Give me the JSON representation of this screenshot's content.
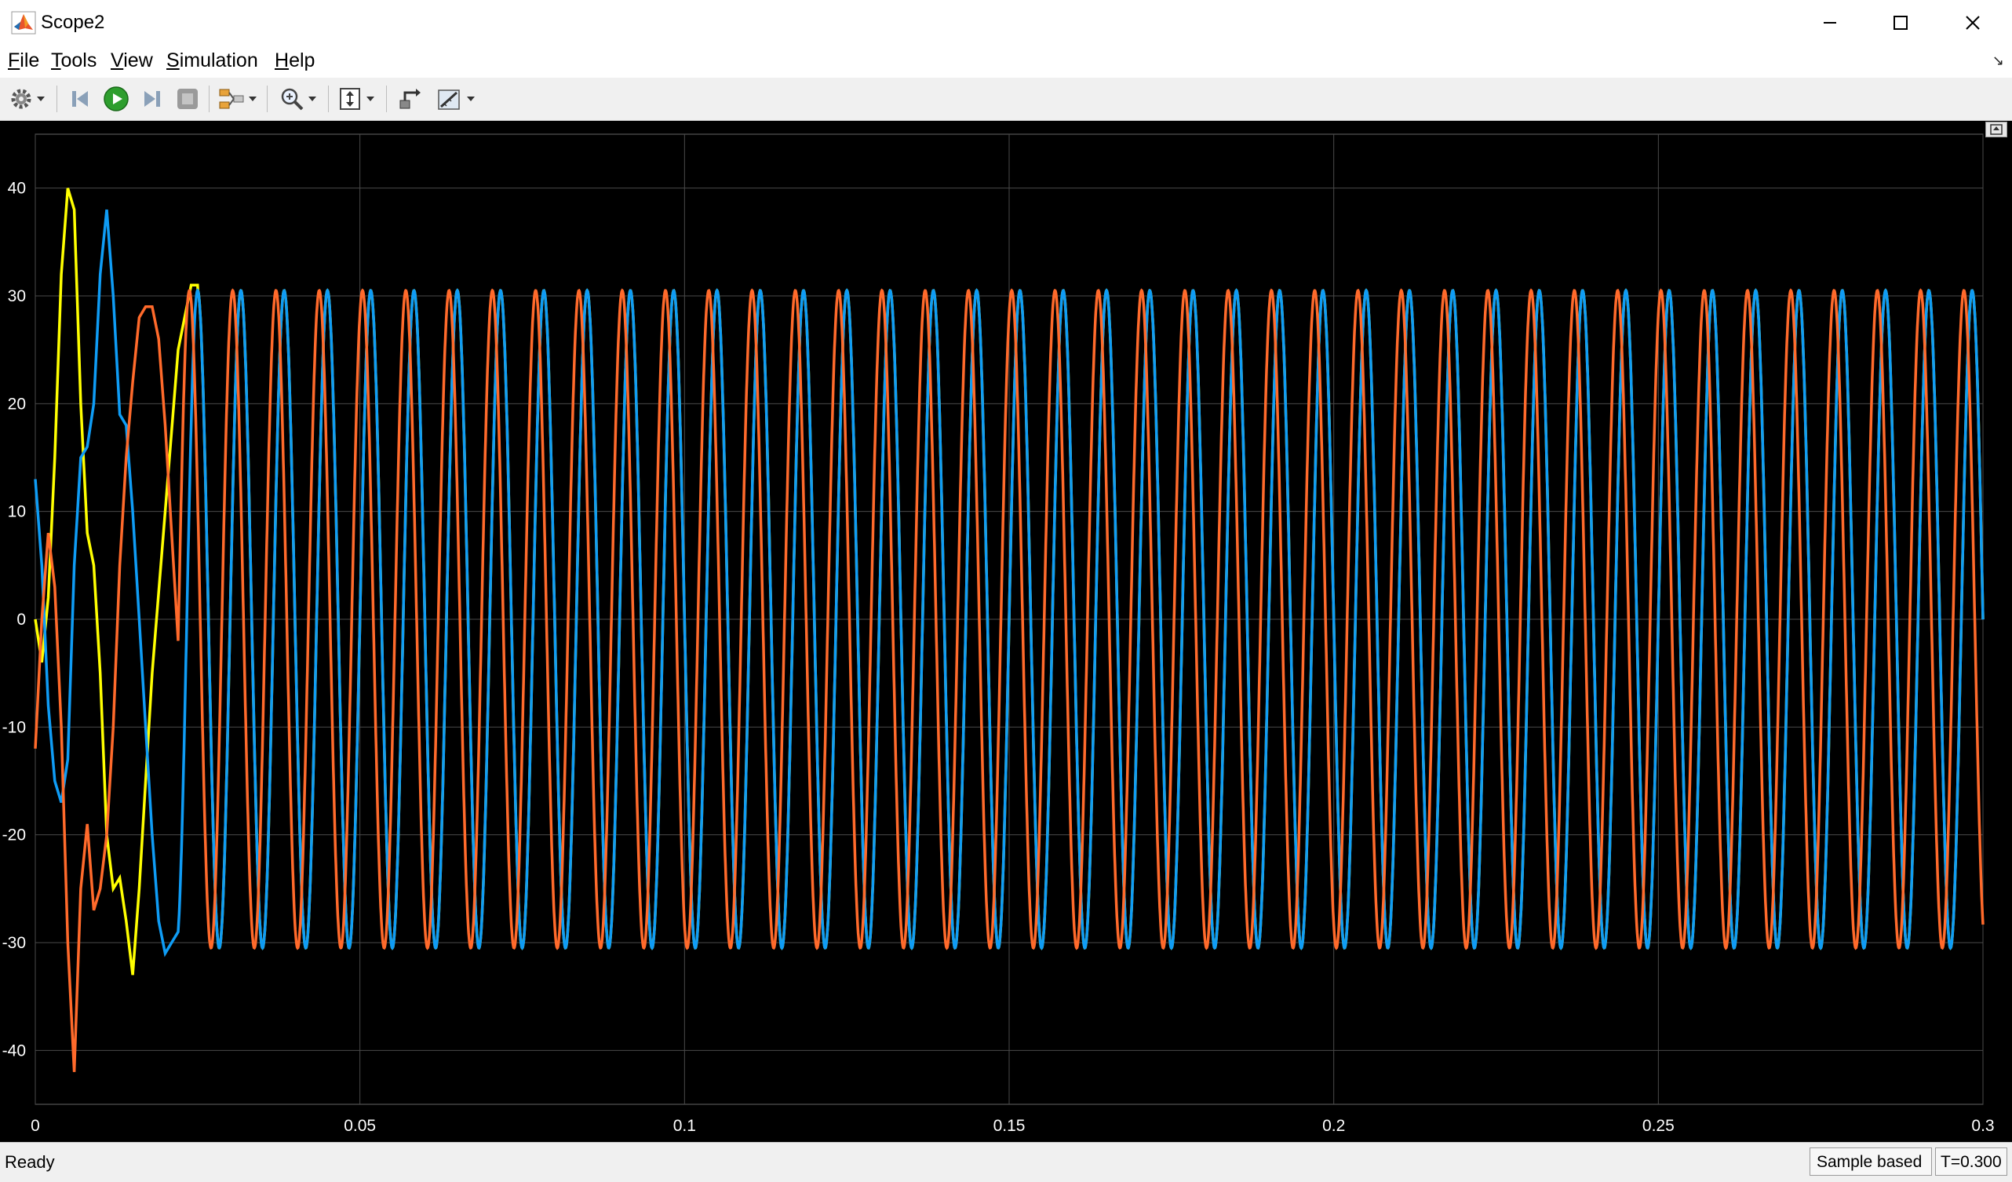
{
  "window": {
    "title": "Scope2"
  },
  "menu": {
    "items": [
      {
        "label": "File",
        "accel": "F",
        "rest": "ile"
      },
      {
        "label": "Tools",
        "accel": "T",
        "rest": "ools"
      },
      {
        "label": "View",
        "accel": "V",
        "rest": "iew"
      },
      {
        "label": "Simulation",
        "accel": "S",
        "rest": "imulation"
      },
      {
        "label": "Help",
        "accel": "H",
        "rest": "elp"
      }
    ]
  },
  "toolbar": {
    "icons": [
      "gear-icon",
      "step-back-icon",
      "run-icon",
      "step-forward-icon",
      "stop-icon",
      "signal-selector-icon",
      "zoom-icon",
      "autoscale-icon",
      "highlight-block-icon",
      "measurement-icon"
    ]
  },
  "status": {
    "text": "Ready",
    "sample_mode": "Sample based",
    "sim_time": "T=0.300"
  },
  "colors": {
    "series_a": "#ffff00",
    "series_b": "#0f9cf5",
    "series_c": "#ff6a2b",
    "grid": "#4a4a4a",
    "background": "#000000"
  },
  "chart_data": {
    "type": "line",
    "title": "",
    "xlabel": "",
    "ylabel": "",
    "xlim": [
      0,
      0.3
    ],
    "ylim": [
      -45,
      45
    ],
    "xticks": [
      0,
      0.05,
      0.1,
      0.15,
      0.2,
      0.25,
      0.3
    ],
    "xtick_labels": [
      "0",
      "0.05",
      "0.1",
      "0.15",
      "0.2",
      "0.25",
      "0.3"
    ],
    "yticks": [
      -40,
      -30,
      -20,
      -10,
      0,
      10,
      20,
      30,
      40
    ],
    "ytick_labels": [
      "-40",
      "-30",
      "-20",
      "-10",
      "0",
      "10",
      "20",
      "30",
      "40"
    ],
    "grid": true,
    "steady_state": {
      "amplitude": 30.5,
      "frequency_hz": 150,
      "phase_offsets_deg": {
        "series_a": 0,
        "series_b": 120,
        "series_c": -120
      }
    },
    "series": [
      {
        "color_key": "series_a",
        "x": [
          0,
          0.001,
          0.002,
          0.003,
          0.004,
          0.005,
          0.006,
          0.007,
          0.008,
          0.009,
          0.01,
          0.011,
          0.012,
          0.013,
          0.014,
          0.015,
          0.016,
          0.017,
          0.018,
          0.02,
          0.022,
          0.024,
          0.025
        ],
        "y": [
          0,
          -4,
          2,
          15,
          32,
          40,
          38,
          20,
          8,
          5,
          -5,
          -20,
          -25,
          -24,
          -28,
          -33,
          -25,
          -15,
          -5,
          10,
          25,
          31,
          31
        ]
      },
      {
        "color_key": "series_b",
        "x": [
          0,
          0.001,
          0.002,
          0.003,
          0.004,
          0.005,
          0.006,
          0.007,
          0.008,
          0.009,
          0.01,
          0.011,
          0.012,
          0.013,
          0.014,
          0.015,
          0.016,
          0.017,
          0.018,
          0.019,
          0.02,
          0.021,
          0.022
        ],
        "y": [
          13,
          5,
          -8,
          -15,
          -17,
          -13,
          5,
          15,
          16,
          20,
          32,
          38,
          30,
          19,
          18,
          10,
          0,
          -10,
          -20,
          -28,
          -31,
          -30,
          -29
        ]
      },
      {
        "color_key": "series_c",
        "x": [
          0,
          0.001,
          0.002,
          0.003,
          0.004,
          0.005,
          0.006,
          0.007,
          0.008,
          0.009,
          0.01,
          0.011,
          0.012,
          0.013,
          0.014,
          0.015,
          0.016,
          0.017,
          0.018,
          0.019,
          0.02,
          0.021,
          0.022
        ],
        "y": [
          -12,
          0,
          8,
          3,
          -10,
          -30,
          -42,
          -25,
          -19,
          -27,
          -25,
          -20,
          -10,
          5,
          15,
          22,
          28,
          29,
          29,
          26,
          18,
          8,
          -2
        ]
      }
    ]
  }
}
